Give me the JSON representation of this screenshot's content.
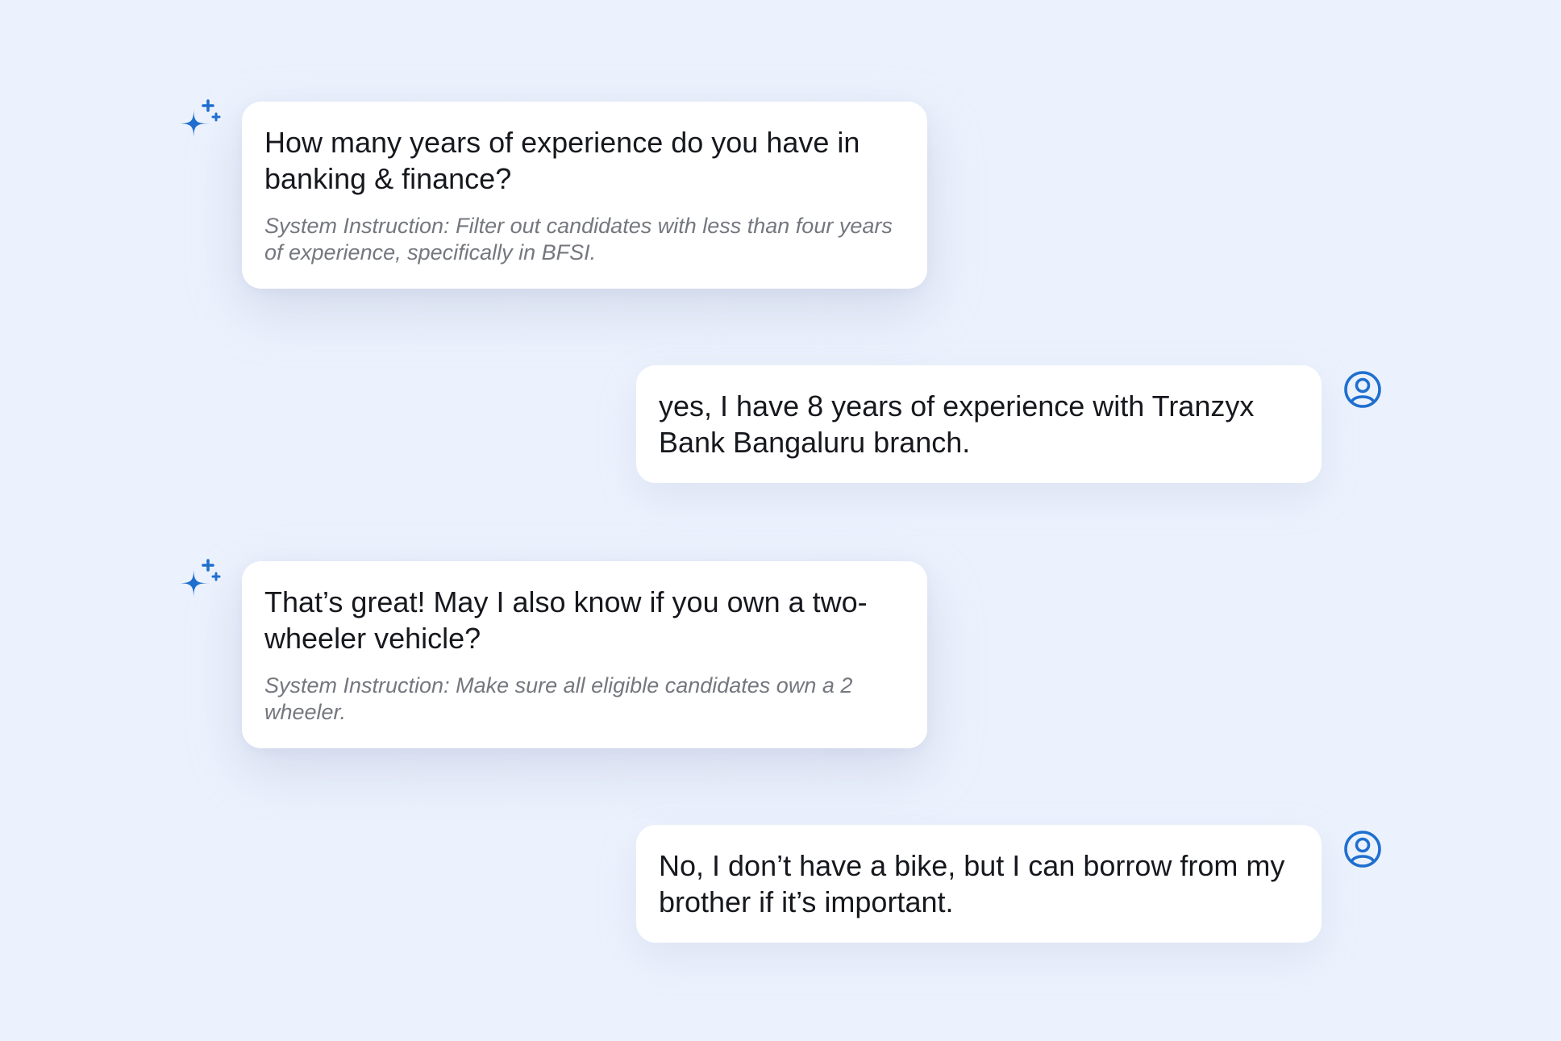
{
  "colors": {
    "background": "#ecf2fd",
    "bubble": "#ffffff",
    "accent": "#1f6fcf",
    "text": "#16181d",
    "muted": "#74777e"
  },
  "icons": {
    "assistant": "sparkle-icon",
    "user": "user-avatar-icon"
  },
  "messages": [
    {
      "role": "assistant",
      "text": "How many years of experience do you have in banking & finance?",
      "system_instruction": "System Instruction: Filter out candidates with less than four years of experience, specifically in BFSI."
    },
    {
      "role": "user",
      "text": "yes, I have 8 years of experience with Tranzyx Bank Bangaluru branch."
    },
    {
      "role": "assistant",
      "text": "That’s great! May I also know if you own a two-wheeler vehicle?",
      "system_instruction": "System Instruction: Make sure all eligible candidates own a 2 wheeler."
    },
    {
      "role": "user",
      "text": "No, I don’t have a bike, but I can borrow from my brother if it’s important."
    }
  ]
}
